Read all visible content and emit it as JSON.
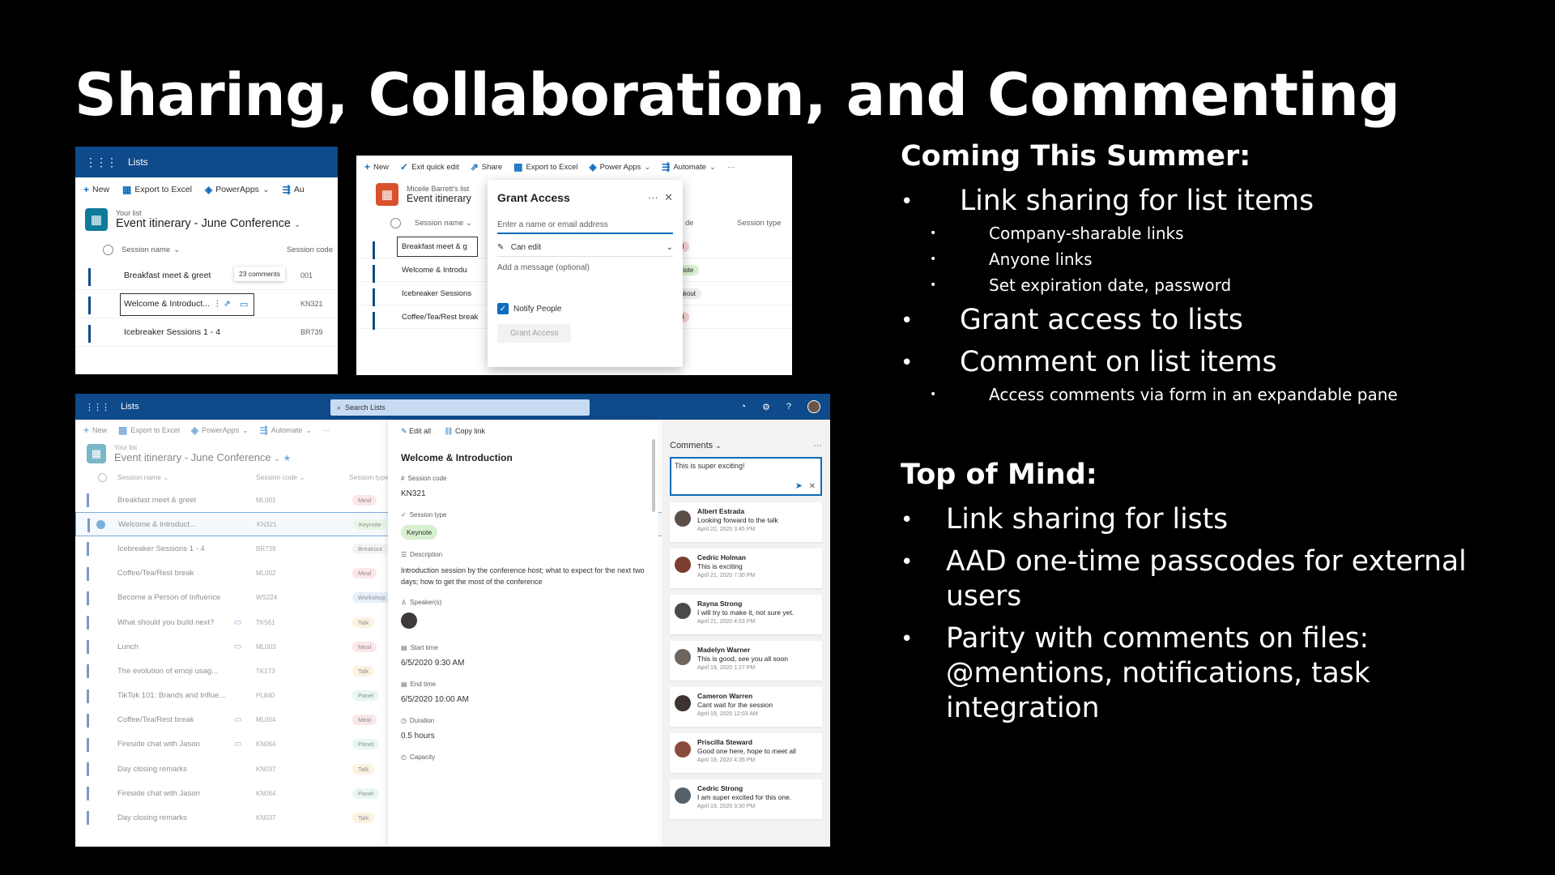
{
  "title": "Sharing, Collaboration, and Commenting",
  "panel1": {
    "app": "Lists",
    "commands": [
      "New",
      "Export to Excel",
      "PowerApps",
      "Au"
    ],
    "list_subtitle": "Your list",
    "list_title": "Event itinerary - June Conference",
    "col_name": "Session name",
    "col_code": "Session code",
    "rows": [
      {
        "name": "Breakfast meet & greet",
        "comments": "23 comments",
        "code": "001"
      },
      {
        "name": "Welcome & Introduct...",
        "code": "KN321"
      },
      {
        "name": "Icebreaker Sessions 1 - 4",
        "code": "BR739"
      }
    ]
  },
  "panel2": {
    "commands": [
      "New",
      "Exit quick edit",
      "Share",
      "Export to Excel",
      "Power Apps",
      "Automate"
    ],
    "list_subtitle": "Miceile Barrett's list",
    "list_title": "Event itinerary",
    "col_name": "Session name",
    "col_de": "de",
    "col_type": "Session type",
    "rows": [
      {
        "name": "Breakfast meet & g",
        "type": "Meal"
      },
      {
        "name": "Welcome & Introdu",
        "type": "Keynote"
      },
      {
        "name": "Icebreaker Sessions",
        "type": "Breakout"
      },
      {
        "name": "Coffee/Tea/Rest break",
        "type": "Meal"
      }
    ],
    "dialog": {
      "title": "Grant Access",
      "placeholder": "Enter a name or email address",
      "permission": "Can edit",
      "message": "Add a message (optional)",
      "notify": "Notify People",
      "button": "Grant Access"
    }
  },
  "panel3": {
    "app": "Lists",
    "search_placeholder": "Search Lists",
    "commands": [
      "New",
      "Export to Excel",
      "PowerApps",
      "Automate"
    ],
    "list_subtitle": "Your list",
    "list_title": "Event itinerary - June Conference",
    "col_name": "Session name",
    "col_code": "Session code",
    "col_type": "Session type",
    "rows": [
      {
        "name": "Breakfast meet & greet",
        "code": "ML001",
        "type": "Meal"
      },
      {
        "name": "Welcome & Introduct...",
        "code": "KN321",
        "type": "Keynote"
      },
      {
        "name": "Icebreaker Sessions 1 - 4",
        "code": "BR739",
        "type": "Breakout"
      },
      {
        "name": "Coffee/Tea/Rest break",
        "code": "ML002",
        "type": "Meal"
      },
      {
        "name": "Become a Person of Influence",
        "code": "WS224",
        "type": "Workshop"
      },
      {
        "name": "What should you build next?",
        "code": "TK561",
        "type": "Talk"
      },
      {
        "name": "Lunch",
        "code": "ML003",
        "type": "Meal"
      },
      {
        "name": "The evolution of emoji usag...",
        "code": "TK173",
        "type": "Talk"
      },
      {
        "name": "TikTok 101: Brands and Influe...",
        "code": "PL840",
        "type": "Panel"
      },
      {
        "name": "Coffee/Tea/Rest break",
        "code": "ML004",
        "type": "Meal"
      },
      {
        "name": "Fireside chat with Jason",
        "code": "KN064",
        "type": "Panel"
      },
      {
        "name": "Day closing remarks",
        "code": "KN037",
        "type": "Talk"
      },
      {
        "name": "Fireside chat with Jason",
        "code": "KN064",
        "type": "Panel"
      },
      {
        "name": "Day closing remarks",
        "code": "KN037",
        "type": "Talk"
      }
    ],
    "details": {
      "edit_all": "Edit all",
      "copy_link": "Copy link",
      "title": "Welcome & Introduction",
      "session_code_label": "Session code",
      "session_code": "KN321",
      "session_type_label": "Session type",
      "session_type": "Keynote",
      "description_label": "Description",
      "description": "Introduction session by the conference host; what to expect for the next two days; how to get the most of the conference",
      "speakers_label": "Speaker(s)",
      "start_label": "Start time",
      "start": "6/5/2020 9:30 AM",
      "end_label": "End time",
      "end": "6/5/2020 10:00 AM",
      "duration_label": "Duration",
      "duration": "0.5 hours",
      "capacity_label": "Capacity"
    },
    "comments": {
      "header": "Comments",
      "draft": "This is super exciting!",
      "items": [
        {
          "name": "Albert Estrada",
          "text": "Looking forward to the talk",
          "date": "April 22, 2020 3:45 PM"
        },
        {
          "name": "Cedric Holman",
          "text": "This is exciting",
          "date": "April 21, 2020 7:30 PM"
        },
        {
          "name": "Rayna Strong",
          "text": "I will try to make it, not sure yet.",
          "date": "April 21, 2020 4:53 PM"
        },
        {
          "name": "Madelyn Warner",
          "text": "This is good, see you all soon",
          "date": "April 19, 2020 1:27 PM"
        },
        {
          "name": "Cameron Warren",
          "text": "Cant wait for the session",
          "date": "April 19, 2020 12:03 AM"
        },
        {
          "name": "Priscilla Steward",
          "text": "Good one here, hope to meet all",
          "date": "April 19, 2020 4:35 PM"
        },
        {
          "name": "Cedric Strong",
          "text": "I am super excited for this one.",
          "date": "April 19, 2020 3:30 PM"
        }
      ]
    }
  },
  "right": {
    "coming_heading": "Coming This Summer:",
    "b1": "Link sharing for list items",
    "b1_sub": [
      "Company-sharable links",
      "Anyone links",
      "Set expiration date, password"
    ],
    "b2": "Grant access to lists",
    "b3": "Comment on list items",
    "b3_sub": "Access comments via form in an expandable pane",
    "top_heading": "Top of Mind:",
    "t1": "Link sharing for lists",
    "t2_l1": "AAD one-time passcodes for external",
    "t2_l2": "users",
    "t3_l1": "Parity with comments on files:",
    "t3_l2": "@mentions, notifications, task",
    "t3_l3": "integration"
  },
  "pill_colors": {
    "Meal": "#f8d3d6",
    "Keynote": "#d7f0d0",
    "Breakout": "#eceaea",
    "Workshop": "#cfe4f7",
    "Talk": "#fbe9c8",
    "Panel": "#d6f2ea"
  }
}
